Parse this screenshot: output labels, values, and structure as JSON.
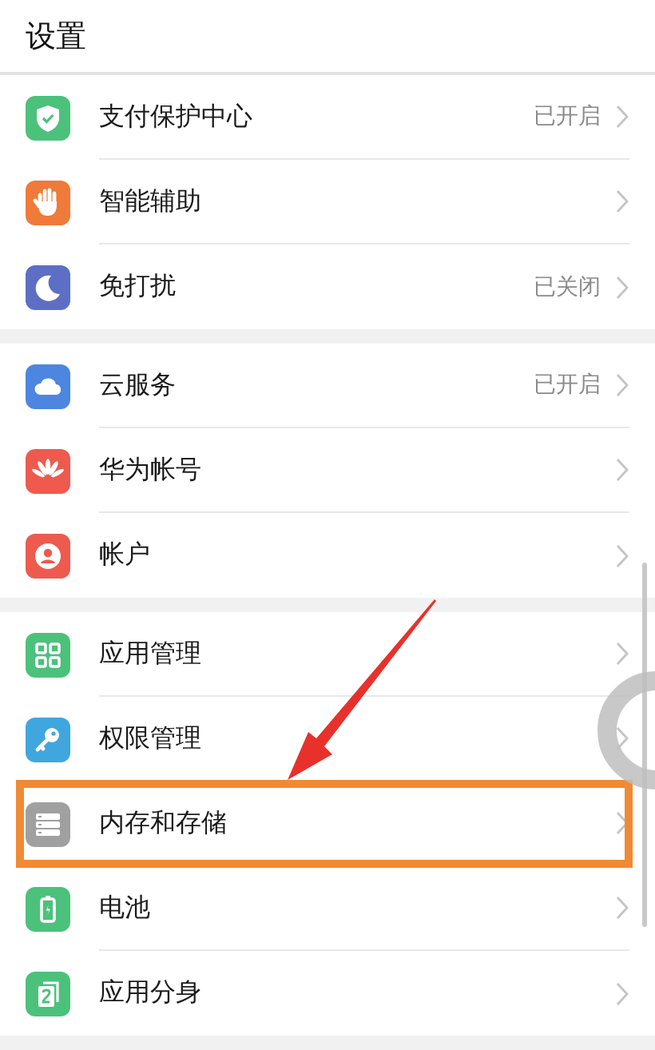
{
  "title": "设置",
  "sections": [
    {
      "items": [
        {
          "label": "支付保护中心",
          "value": "已开启",
          "highlighted": false
        },
        {
          "label": "智能辅助",
          "highlighted": false
        },
        {
          "label": "免打扰",
          "value": "已关闭",
          "highlighted": false
        }
      ]
    },
    {
      "items": [
        {
          "label": "云服务",
          "value": "已开启",
          "highlighted": false
        },
        {
          "label": "华为帐号",
          "highlighted": false
        },
        {
          "label": "帐户",
          "highlighted": false
        }
      ]
    },
    {
      "items": [
        {
          "label": "应用管理",
          "highlighted": false
        },
        {
          "label": "权限管理",
          "highlighted": false
        },
        {
          "label": "内存和存储",
          "highlighted": true
        },
        {
          "label": "电池",
          "highlighted": false
        },
        {
          "label": "应用分身",
          "highlighted": false
        }
      ]
    }
  ]
}
